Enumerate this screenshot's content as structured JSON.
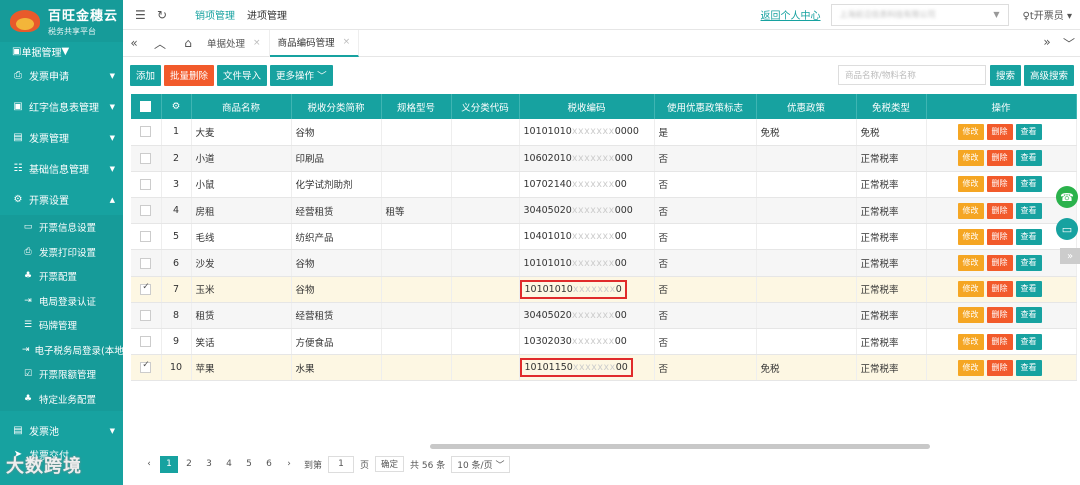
{
  "app": {
    "title": "百旺金穗云",
    "subtitle": "税务共享平台"
  },
  "colors": {
    "accent": "#17a2a0",
    "danger": "#f25a2b",
    "warning": "#f5a623"
  },
  "sidebar": {
    "top_item": "单据管理",
    "items": [
      {
        "label": "发票申请",
        "icon": "printer-icon"
      },
      {
        "label": "红字信息表管理",
        "icon": "file-icon"
      },
      {
        "label": "发票管理",
        "icon": "document-icon"
      },
      {
        "label": "基础信息管理",
        "icon": "sliders-icon"
      },
      {
        "label": "开票设置",
        "icon": "gear-icon"
      }
    ],
    "sub_items": [
      {
        "label": "开票信息设置",
        "icon": "monitor-icon"
      },
      {
        "label": "发票打印设置",
        "icon": "printer-icon"
      },
      {
        "label": "开票配置",
        "icon": "network-icon"
      },
      {
        "label": "电局登录认证",
        "icon": "login-icon"
      },
      {
        "label": "码牌管理",
        "icon": "list-icon"
      },
      {
        "label": "电子税务局登录(本地",
        "icon": "login-icon"
      },
      {
        "label": "开票限额管理",
        "icon": "check-square-icon"
      },
      {
        "label": "特定业务配置",
        "icon": "network-icon"
      }
    ],
    "bottom_item": "发票池",
    "bottom_item2": "发票交付"
  },
  "topbar": {
    "tabs": [
      "销项管理",
      "进项管理"
    ],
    "personal_center": "返回个人中心",
    "company": "上海前沿信息科技有限公司",
    "user": "t开票员"
  },
  "pagetabs": [
    {
      "label": "单据处理"
    },
    {
      "label": "商品编码管理"
    }
  ],
  "toolbar": {
    "add": "添加",
    "batch_delete": "批量删除",
    "import": "文件导入",
    "more": "更多操作",
    "search_placeholder": "商品名称/物料名称",
    "search": "搜索",
    "advanced": "高级搜索"
  },
  "table": {
    "columns": [
      "商品名称",
      "税收分类简称",
      "规格型号",
      "义分类代码",
      "税收编码",
      "使用优惠政策标志",
      "优惠政策",
      "免税类型",
      "操作"
    ],
    "actions": {
      "edit": "修改",
      "delete": "删除",
      "view": "查看"
    },
    "rows": [
      {
        "no": "1",
        "name": "大麦",
        "category": "谷物",
        "spec": "",
        "code_a": "10101010",
        "code_b": "0000",
        "promo_flag": "是",
        "promo": "免税",
        "tax_type": "免税",
        "checked": false,
        "highlight": false
      },
      {
        "no": "2",
        "name": "小道",
        "category": "印刷品",
        "spec": "",
        "code_a": "10602010",
        "code_b": "000",
        "promo_flag": "否",
        "promo": "",
        "tax_type": "正常税率",
        "checked": false,
        "highlight": false
      },
      {
        "no": "3",
        "name": "小鼠",
        "category": "化学试剂助剂",
        "spec": "",
        "code_a": "10702140",
        "code_b": "00",
        "promo_flag": "否",
        "promo": "",
        "tax_type": "正常税率",
        "checked": false,
        "highlight": false
      },
      {
        "no": "4",
        "name": "房租",
        "category": "经营租赁",
        "spec": "租等",
        "code_a": "30405020",
        "code_b": "000",
        "promo_flag": "否",
        "promo": "",
        "tax_type": "正常税率",
        "checked": false,
        "highlight": false
      },
      {
        "no": "5",
        "name": "毛线",
        "category": "纺织产品",
        "spec": "",
        "code_a": "10401010",
        "code_b": "00",
        "promo_flag": "否",
        "promo": "",
        "tax_type": "正常税率",
        "checked": false,
        "highlight": false
      },
      {
        "no": "6",
        "name": "沙发",
        "category": "谷物",
        "spec": "",
        "code_a": "10101010",
        "code_b": "00",
        "promo_flag": "否",
        "promo": "",
        "tax_type": "正常税率",
        "checked": false,
        "highlight": false
      },
      {
        "no": "7",
        "name": "玉米",
        "category": "谷物",
        "spec": "",
        "code_a": "10101010",
        "code_b": "0",
        "promo_flag": "否",
        "promo": "",
        "tax_type": "正常税率",
        "checked": true,
        "highlight": true
      },
      {
        "no": "8",
        "name": "租赁",
        "category": "经营租赁",
        "spec": "",
        "code_a": "30405020",
        "code_b": "00",
        "promo_flag": "否",
        "promo": "",
        "tax_type": "正常税率",
        "checked": false,
        "highlight": false
      },
      {
        "no": "9",
        "name": "笑话",
        "category": "方便食品",
        "spec": "",
        "code_a": "10302030",
        "code_b": "00",
        "promo_flag": "否",
        "promo": "",
        "tax_type": "正常税率",
        "checked": false,
        "highlight": false
      },
      {
        "no": "10",
        "name": "苹果",
        "category": "水果",
        "spec": "",
        "code_a": "10101150",
        "code_b": "00",
        "promo_flag": "否",
        "promo": "免税",
        "tax_type": "正常税率",
        "checked": true,
        "highlight": true
      }
    ]
  },
  "pager": {
    "pages": [
      "1",
      "2",
      "3",
      "4",
      "5",
      "6"
    ],
    "current": "1",
    "goto_label": "到第",
    "goto_value": "1",
    "page_unit": "页",
    "confirm": "确定",
    "total": "共 56 条",
    "page_size": "10 条/页"
  },
  "watermark": "大数跨境"
}
